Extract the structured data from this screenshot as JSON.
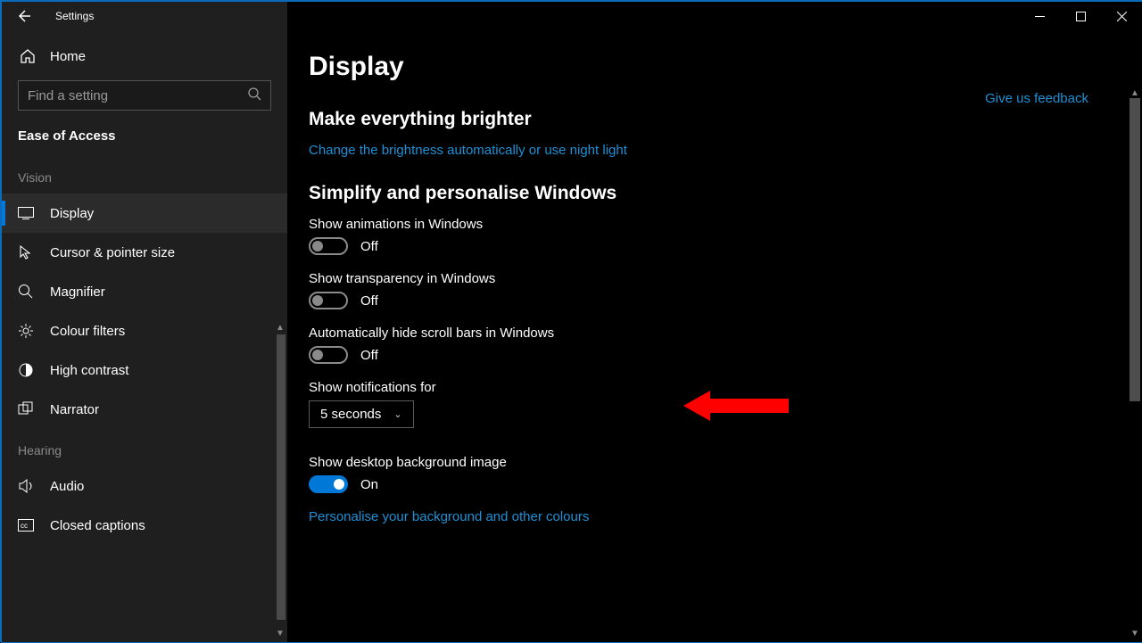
{
  "window": {
    "title": "Settings"
  },
  "sidebar": {
    "home": "Home",
    "search_placeholder": "Find a setting",
    "section": "Ease of Access",
    "groups": [
      {
        "label": "Vision",
        "items": [
          {
            "id": "display",
            "label": "Display",
            "icon": "monitor",
            "active": true
          },
          {
            "id": "cursor",
            "label": "Cursor & pointer size",
            "icon": "cursor"
          },
          {
            "id": "magnifier",
            "label": "Magnifier",
            "icon": "magnifier"
          },
          {
            "id": "colour",
            "label": "Colour filters",
            "icon": "brightness"
          },
          {
            "id": "contrast",
            "label": "High contrast",
            "icon": "contrast"
          },
          {
            "id": "narrator",
            "label": "Narrator",
            "icon": "narrator"
          }
        ]
      },
      {
        "label": "Hearing",
        "items": [
          {
            "id": "audio",
            "label": "Audio",
            "icon": "speaker"
          },
          {
            "id": "captions",
            "label": "Closed captions",
            "icon": "captions"
          }
        ]
      }
    ]
  },
  "content": {
    "page_title": "Display",
    "feedback": "Give us feedback",
    "sec1_title": "Make everything brighter",
    "sec1_link": "Change the brightness automatically or use night light",
    "sec2_title": "Simplify and personalise Windows",
    "opt_animations": {
      "label": "Show animations in Windows",
      "state": "Off",
      "on": false
    },
    "opt_transparency": {
      "label": "Show transparency in Windows",
      "state": "Off",
      "on": false
    },
    "opt_scrollbars": {
      "label": "Automatically hide scroll bars in Windows",
      "state": "Off",
      "on": false
    },
    "opt_notifications": {
      "label": "Show notifications for",
      "value": "5 seconds"
    },
    "opt_desktop_bg": {
      "label": "Show desktop background image",
      "state": "On",
      "on": true
    },
    "personalise_link": "Personalise your background and other colours"
  }
}
